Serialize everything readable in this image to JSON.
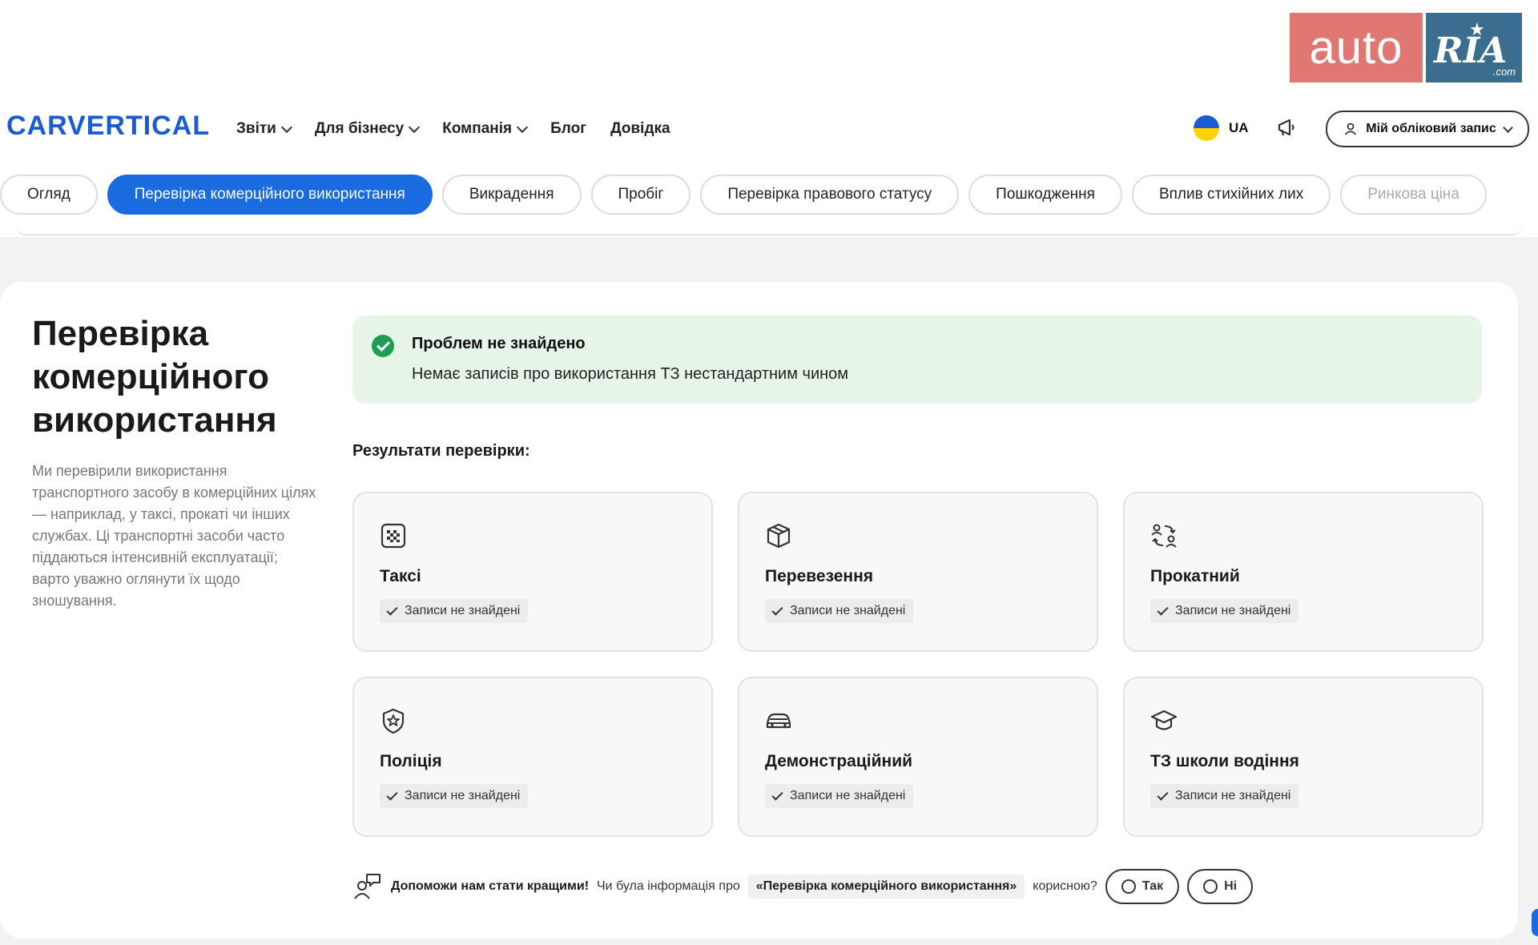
{
  "watermark": {
    "auto": "auto",
    "ria": "RIA",
    "com": ".com"
  },
  "header": {
    "logo": "CARVERTICAL",
    "nav": [
      "Звіти",
      "Для бізнесу",
      "Компанія",
      "Блог",
      "Довідка"
    ],
    "lang": "UA",
    "account": "Мій обліковий запис"
  },
  "tabs": [
    "Огляд",
    "Перевірка комерційного використання",
    "Викрадення",
    "Пробіг",
    "Перевірка правового статусу",
    "Пошкодження",
    "Вплив стихійних лих",
    "Ринкова ціна"
  ],
  "active_tab": "Перевірка комерційного використання",
  "section": {
    "title": "Перевірка комерційного використання",
    "description": "Ми перевірили використання транспортного засобу в комерційних цілях — наприклад, у таксі, прокаті чи інших службах. Ці транспортні засоби часто піддаються інтенсивній експлуатації; варто уважно оглянути їх щодо зношування."
  },
  "status": {
    "title": "Проблем не знайдено",
    "message": "Немає записів про використання ТЗ нестандартним чином"
  },
  "results_label": "Результати перевірки:",
  "results": [
    {
      "name": "Таксі",
      "status": "Записи не знайдені",
      "icon": "taxi-icon"
    },
    {
      "name": "Перевезення",
      "status": "Записи не знайдені",
      "icon": "box-icon"
    },
    {
      "name": "Прокатний",
      "status": "Записи не знайдені",
      "icon": "rental-icon"
    },
    {
      "name": "Поліція",
      "status": "Записи не знайдені",
      "icon": "police-badge-icon"
    },
    {
      "name": "Демонстраційний",
      "status": "Записи не знайдені",
      "icon": "car-icon"
    },
    {
      "name": "ТЗ школи водіння",
      "status": "Записи не знайдені",
      "icon": "graduation-cap-icon"
    }
  ],
  "feedback": {
    "lead": "Допоможи нам стати кращими!",
    "question_pre": "Чи була інформація про",
    "topic": "«Перевірка комерційного використання»",
    "question_post": "корисною?",
    "yes": "Так",
    "no": "Ні"
  },
  "colors": {
    "primary": "#1a6ae0",
    "success_bg": "#e6f5e8",
    "success_icon": "#1f9d55"
  }
}
